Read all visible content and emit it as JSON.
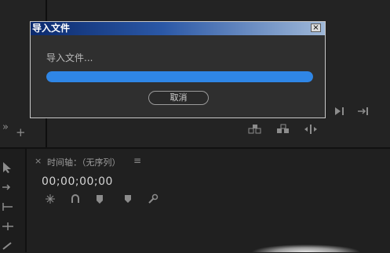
{
  "dialog": {
    "title": "导入文件",
    "close_label": "×",
    "message": "导入文件...",
    "progress": 1.0,
    "cancel_label": "取消"
  },
  "program_monitor": {
    "expand_label": "»",
    "add_label": "+",
    "icons": [
      "play-forward-icon",
      "go-to-out-icon",
      "lift-icon",
      "extract-icon",
      "compare-icon"
    ]
  },
  "timeline": {
    "close_label": "×",
    "title": "时间轴：（无序列）",
    "menu_label": "≡",
    "timecode": "00;00;00;00",
    "icons": [
      "snap-icon",
      "linked-selection-icon",
      "add-marker-icon",
      "marker-icon",
      "wrench-icon"
    ]
  },
  "tools": [
    "selection-tool-icon",
    "track-select-forward-icon",
    "ripple-edit-icon",
    "rolling-edit-icon",
    "razor-icon"
  ],
  "colors": {
    "accent": "#2f86e6",
    "background": "#1f1f1f",
    "titlebar": "#0b2a6e"
  }
}
